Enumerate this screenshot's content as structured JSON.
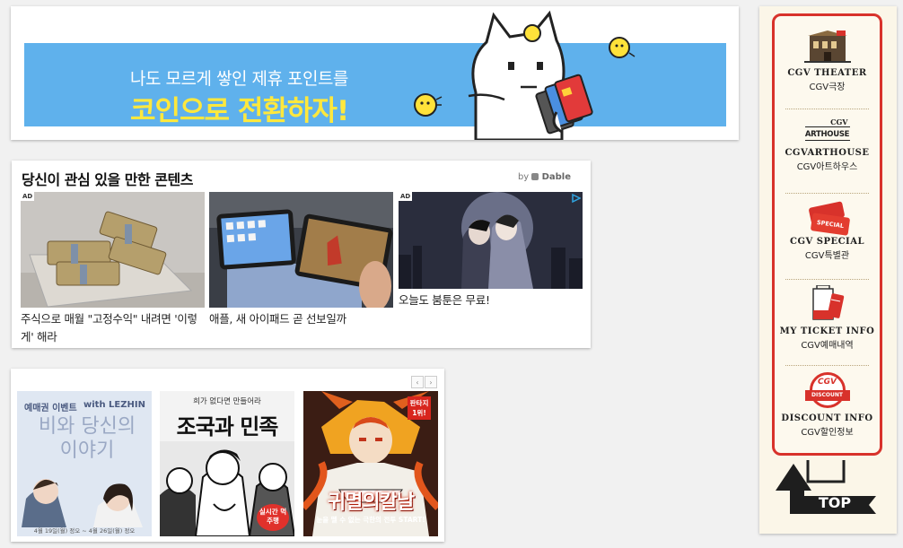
{
  "banner": {
    "subtitle": "나도 모르게 쌓인 제휴 포인트를",
    "headline": "코인으로 전환하자!"
  },
  "recommended": {
    "title": "당신이 관심 있을 만한 콘텐츠",
    "provider_prefix": "by",
    "provider": "Dable",
    "ad_label": "AD",
    "items": [
      {
        "caption": "주식으로 매월 \"고정수익\" 내려면 '이렇게' 해라",
        "ad": true
      },
      {
        "caption": "애플, 새 아이패드 곧 선보일까",
        "ad": false
      },
      {
        "caption": "오늘도 붐툰은 무료!",
        "ad": true
      }
    ]
  },
  "webtoons": {
    "prev": "‹",
    "next": "›",
    "items": [
      {
        "line1": "예매권 이벤트",
        "brand": "with LEZHIN",
        "title": "비와 당신의 이야기",
        "footer": "4월 19일(월) 정오 ~ 4월 26일(월) 정오"
      },
      {
        "tagline": "희가 없다면 만들어라",
        "title": "조국과 민족",
        "badge": "실시간 먹주행"
      },
      {
        "badge": "판타지 1위!",
        "title": "귀멸의칼날",
        "footer": "눈을 뗄 수 없는 극한의 전투 START!"
      }
    ]
  },
  "sidebar": {
    "items": [
      {
        "en": "CGV THEATER",
        "ko": "CGV극장",
        "icon": "theater-icon"
      },
      {
        "en": "CGVARTHOUSE",
        "ko": "CGV아트하우스",
        "icon": "arthouse-icon",
        "logo_top": "CGV",
        "logo_bottom": "ARTHOUSE"
      },
      {
        "en": "CGV SPECIAL",
        "ko": "CGV특별관",
        "icon": "special-ticket-icon",
        "logo": "SPECIAL"
      },
      {
        "en": "MY TICKET INFO",
        "ko": "CGV예매내역",
        "icon": "ticket-icon"
      },
      {
        "en": "DISCOUNT INFO",
        "ko": "CGV할인정보",
        "icon": "discount-icon",
        "logo_top": "CGV",
        "logo_bottom": "DISCOUNT"
      }
    ],
    "top_label": "TOP"
  },
  "colors": {
    "banner_bg": "#5fb1ec",
    "banner_headline": "#ffe83d",
    "cgv_red": "#d8322b",
    "sidebar_bg": "#fbf6e8"
  }
}
